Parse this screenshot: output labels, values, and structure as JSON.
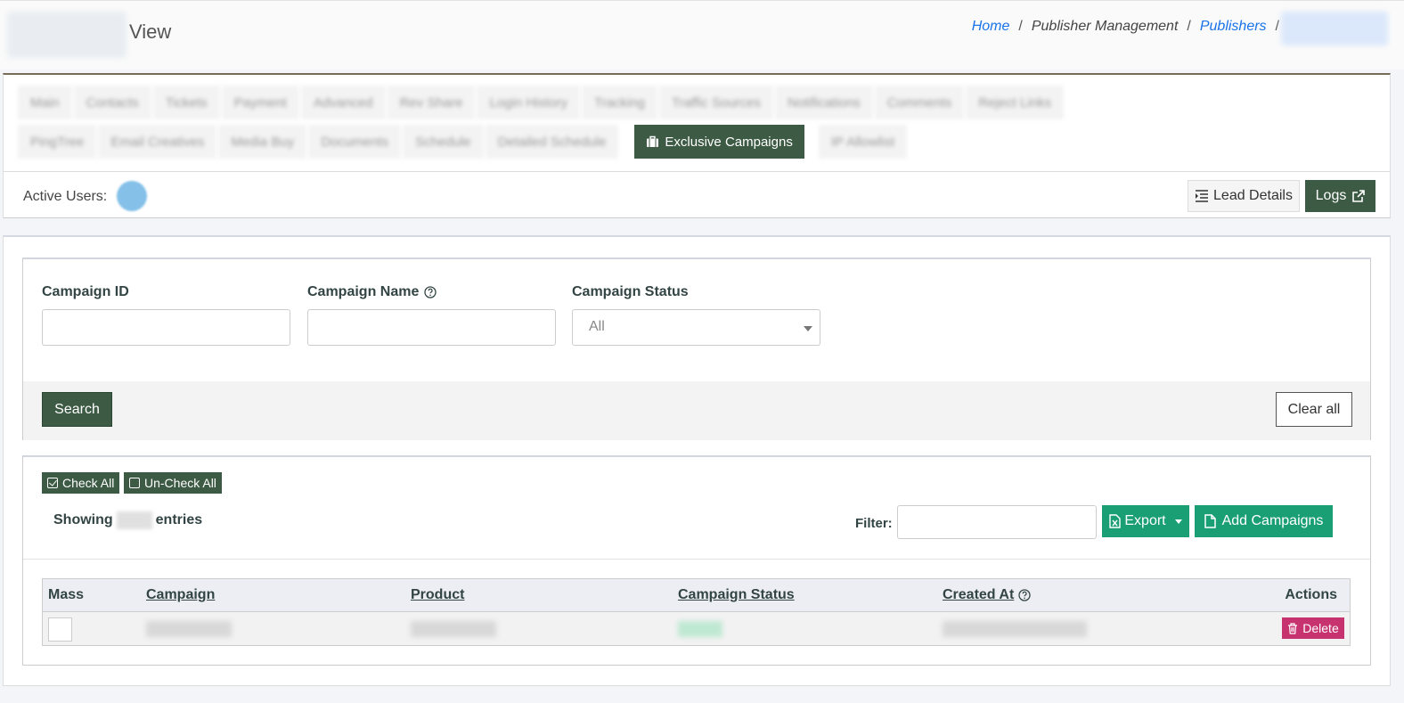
{
  "header": {
    "title": "View",
    "breadcrumb": {
      "home": "Home",
      "sep1": "/",
      "section": "Publisher Management",
      "sep2": "/",
      "publishers": "Publishers",
      "sep3": "/"
    }
  },
  "tabs": {
    "row1": [
      "Main",
      "Contacts",
      "Tickets",
      "Payment",
      "Advanced",
      "Rev Share",
      "Login History",
      "Tracking",
      "Traffic Sources",
      "Notifications",
      "Comments",
      "Reject Links"
    ],
    "row2_before": [
      "PingTree",
      "Email Creatives",
      "Media Buy",
      "Documents",
      "Schedule",
      "Detailed Schedule"
    ],
    "active": "Exclusive Campaigns",
    "row2_after": [
      "IP Allowlist"
    ]
  },
  "toolbar": {
    "active_users_label": "Active Users:",
    "lead_details_label": "Lead Details",
    "logs_label": "Logs"
  },
  "filters": {
    "campaign_id_label": "Campaign ID",
    "campaign_name_label": "Campaign Name",
    "campaign_status_label": "Campaign Status",
    "campaign_status_value": "All",
    "search_label": "Search",
    "clear_label": "Clear all"
  },
  "list": {
    "check_all_label": "Check All",
    "uncheck_all_label": "Un-Check All",
    "showing_prefix": "Showing",
    "showing_suffix": "entries",
    "filter_label": "Filter:",
    "export_label": "Export",
    "add_campaigns_label": "Add Campaigns",
    "columns": {
      "mass": "Mass",
      "campaign": "Campaign",
      "product": "Product",
      "status": "Campaign Status",
      "created": "Created At",
      "actions": "Actions"
    },
    "row_action": "Delete"
  },
  "colors": {
    "primary_dark_green": "#3c5a44",
    "accent_green": "#1a9e73",
    "delete_pink": "#c7336f",
    "link_blue": "#1a73e8"
  }
}
